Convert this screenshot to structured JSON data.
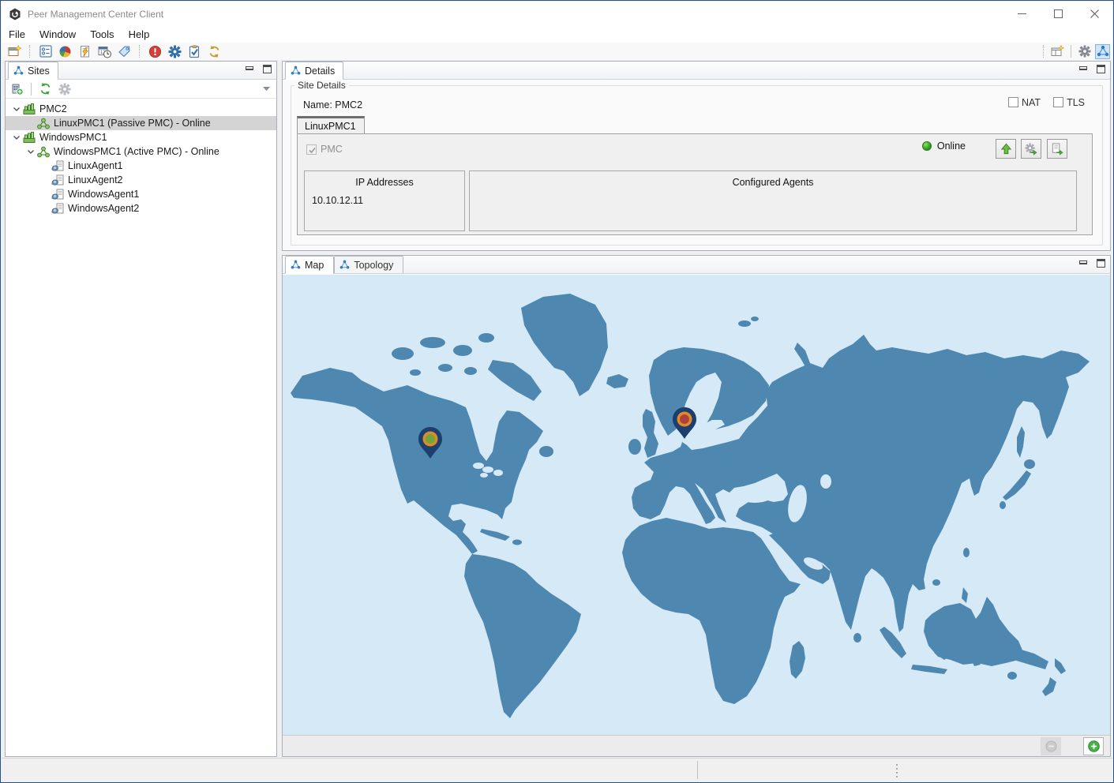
{
  "window": {
    "title": "Peer Management Center Client"
  },
  "menu": {
    "items": [
      "File",
      "Window",
      "Tools",
      "Help"
    ]
  },
  "sites_panel": {
    "tab": "Sites",
    "tree": [
      {
        "label": "PMC2",
        "type": "site",
        "depth": 0,
        "expanded": true
      },
      {
        "label": "LinuxPMC1 (Passive PMC) - Online",
        "type": "pmc",
        "depth": 1,
        "selected": true
      },
      {
        "label": "WindowsPMC1",
        "type": "site",
        "depth": 0,
        "expanded": true
      },
      {
        "label": "WindowsPMC1 (Active PMC) - Online",
        "type": "pmc",
        "depth": 1,
        "expanded": true
      },
      {
        "label": "LinuxAgent1",
        "type": "agent",
        "depth": 2
      },
      {
        "label": "LinuxAgent2",
        "type": "agent",
        "depth": 2
      },
      {
        "label": "WindowsAgent1",
        "type": "agent",
        "depth": 2
      },
      {
        "label": "WindowsAgent2",
        "type": "agent",
        "depth": 2
      }
    ]
  },
  "details_panel": {
    "tab": "Details",
    "group_title": "Site Details",
    "name_label": "Name: PMC2",
    "nat_label": "NAT",
    "tls_label": "TLS",
    "site_tab": "LinuxPMC1",
    "pmc_checkbox_label": "PMC",
    "status": "Online",
    "ip_box_title": "IP Addresses",
    "ip_address": "10.10.12.11",
    "agents_box_title": "Configured Agents"
  },
  "map_panel": {
    "tabs": [
      "Map",
      "Topology"
    ],
    "active_tab": "Map",
    "colors": {
      "ocean": "#d6e9f7",
      "land": "#4e87af",
      "pin_body": "#1c3f6e",
      "pin_ring": "#dd8c2c",
      "pin1_center": "#74a63e",
      "pin2_center": "#b04040"
    },
    "pins": [
      {
        "name": "us-site",
        "center_color": "#74a63e"
      },
      {
        "name": "europe-site",
        "center_color": "#b04040"
      }
    ]
  }
}
